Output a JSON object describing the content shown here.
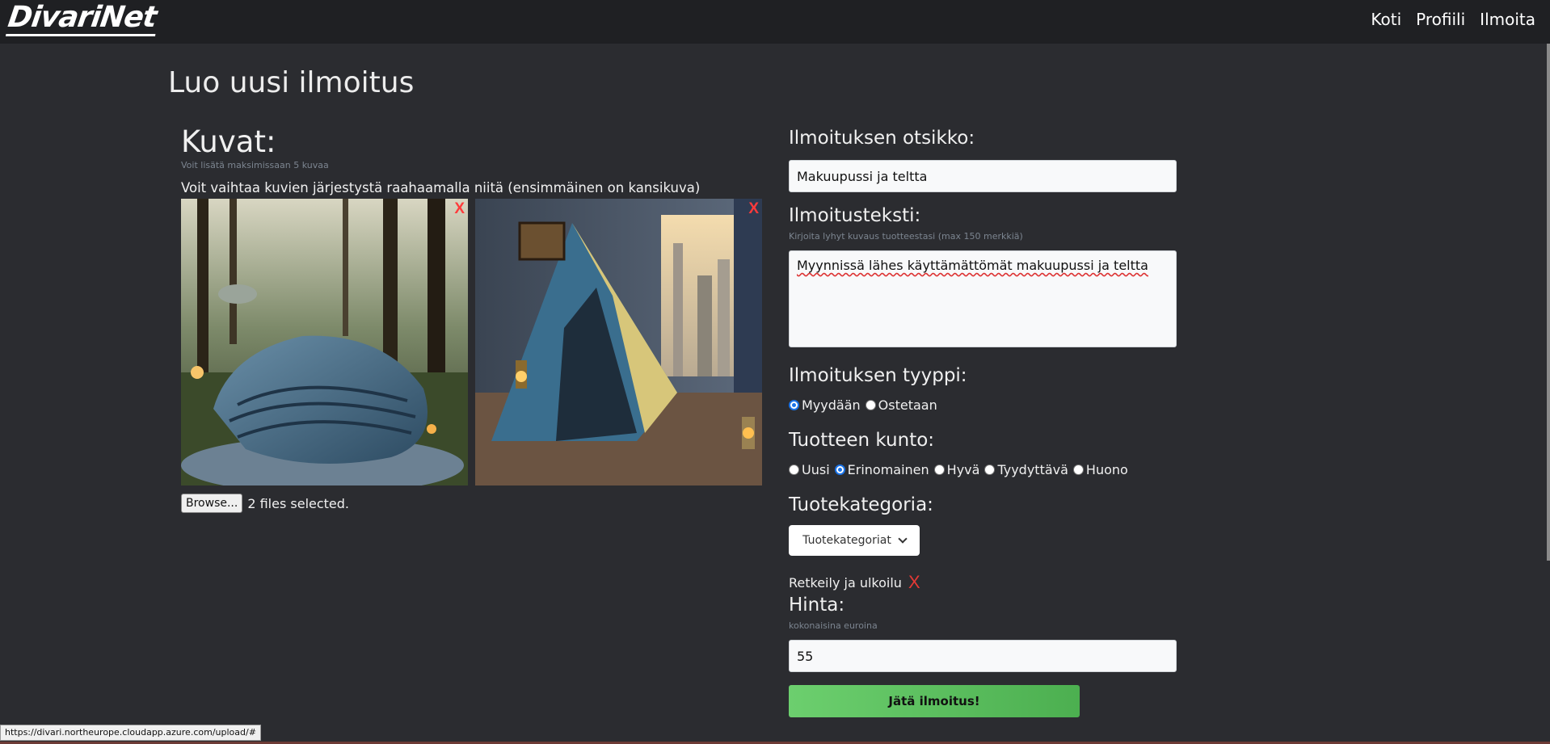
{
  "nav": {
    "logo": "DivariNet",
    "links": [
      "Koti",
      "Profiili",
      "Ilmoita"
    ]
  },
  "page_title": "Luo uusi ilmoitus",
  "images": {
    "title": "Kuvat:",
    "hint": "Voit lisätä maksimissaan 5 kuvaa",
    "reorder_text": "Voit vaihtaa kuvien järjestystä raahaamalla niitä (ensimmäinen on kansikuva)",
    "remove_label": "X",
    "browse_label": "Browse...",
    "file_status": "2 files selected."
  },
  "form": {
    "title_label": "Ilmoituksen otsikko:",
    "title_value": "Makuupussi ja teltta",
    "text_label": "Ilmoitusteksti:",
    "text_hint": "Kirjoita lyhyt kuvaus tuotteestasi (max 150 merkkiä)",
    "text_value": "Myynnissä lähes käyttämättömät makuupussi ja teltta",
    "type_label": "Ilmoituksen tyyppi:",
    "type_options": [
      "Myydään",
      "Ostetaan"
    ],
    "type_selected": "Myydään",
    "condition_label": "Tuotteen kunto:",
    "condition_options": [
      "Uusi",
      "Erinomainen",
      "Hyvä",
      "Tyydyttävä",
      "Huono"
    ],
    "condition_selected": "Erinomainen",
    "category_label": "Tuotekategoria:",
    "category_dropdown": "Tuotekategoriat",
    "selected_category": "Retkeily ja ulkoilu",
    "category_remove": "X",
    "price_label": "Hinta:",
    "price_hint": "kokonaisina euroina",
    "price_value": "55",
    "submit_label": "Jätä ilmoitus!"
  },
  "status_bar": {
    "url": "https://divari.northeurope.cloudapp.azure.com/upload/#"
  },
  "colors": {
    "background": "#2b2c30",
    "navbar": "#1f2023",
    "remove_red": "#ff3b3b",
    "submit_green": "#5cbf60",
    "radio_blue": "#1a73e8"
  }
}
